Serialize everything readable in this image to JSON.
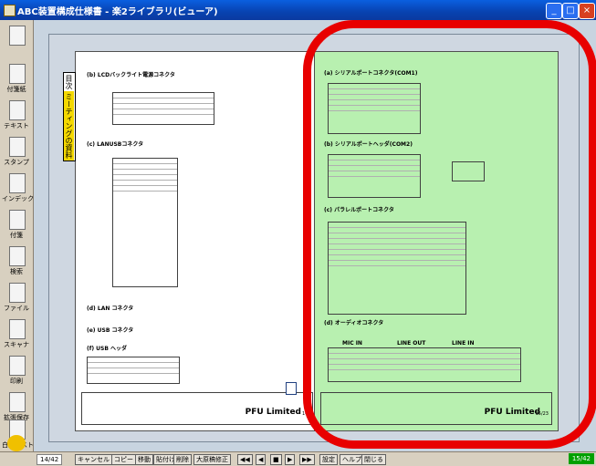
{
  "window": {
    "title": "ABC装置構成仕様書 - 楽2ライブラリ(ビューア)"
  },
  "sidebar": {
    "tools": [
      {
        "label": ""
      },
      {
        "label": "付箋紙"
      },
      {
        "label": "テキスト"
      },
      {
        "label": "スタンプ"
      },
      {
        "label": "インデックス"
      },
      {
        "label": "付箋"
      },
      {
        "label": "検索"
      },
      {
        "label": "ファイル"
      },
      {
        "label": "スキャナ"
      },
      {
        "label": "印刷"
      },
      {
        "label": "拡張保存"
      },
      {
        "label": "白度テスト"
      }
    ]
  },
  "tabs": {
    "items": [
      "目次",
      "ミーティングの資料"
    ]
  },
  "left_page": {
    "sections": [
      "(b) LCDバックライト電源コネクタ",
      "(c) LANUSBコネクタ",
      "(d) LAN コネクタ",
      "(e) USB コネクタ",
      "(f) USB ヘッダ"
    ],
    "company": "PFU Limited",
    "page": "14/"
  },
  "right_page": {
    "sections": [
      "(a) シリアルポートコネクタ(COM1)",
      "(b) シリアルポートヘッダ(COM2)",
      "(c) パラレルポートコネクタ",
      "(d) オーディオコネクタ"
    ],
    "audio_labels": [
      "MIC IN",
      "LINE OUT",
      "LINE IN"
    ],
    "company": "PFU Limited",
    "page": "15/23"
  },
  "bottom": {
    "page_left": "14/42",
    "buttons": [
      "キャンセル",
      "コピー",
      "移動",
      "貼付け",
      "削除",
      "大原稿修正",
      "◀◀",
      "◀",
      "■",
      "▶",
      "▶▶",
      "設定",
      "ヘルプ",
      "閉じる"
    ],
    "page_right": "15/42"
  }
}
